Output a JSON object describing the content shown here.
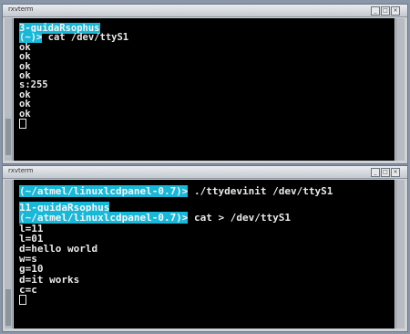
{
  "window1": {
    "title": "rxvterm",
    "controls": [
      "_",
      "□",
      "×"
    ],
    "lines": [
      {
        "host": "3-guidaRsophus"
      },
      {
        "prompt": "(~)>",
        "cmd": " cat /dev/ttyS1"
      },
      {
        "text": "ok"
      },
      {
        "text": "ok"
      },
      {
        "text": "ok"
      },
      {
        "text": "ok"
      },
      {
        "text": "s:255"
      },
      {
        "text": "ok"
      },
      {
        "text": "ok"
      },
      {
        "text": "ok"
      }
    ]
  },
  "window2": {
    "title": "rxvterm",
    "controls": [
      "_",
      "□",
      "×"
    ],
    "lines": [
      {
        "prompt": "(~/atmel/linuxlcdpanel-0.7)>",
        "cmd": " ./ttydevinit /dev/ttyS1"
      },
      {
        "host": "11-guidaRsophus"
      },
      {
        "prompt": "(~/atmel/linuxlcdpanel-0.7)>",
        "cmd": " cat > /dev/ttyS1"
      },
      {
        "text": "l=11"
      },
      {
        "text": "l=01"
      },
      {
        "text": "d=hello world"
      },
      {
        "text": "w=s"
      },
      {
        "text": "g=10"
      },
      {
        "text": "d=it works"
      },
      {
        "text": "c=c"
      }
    ]
  }
}
